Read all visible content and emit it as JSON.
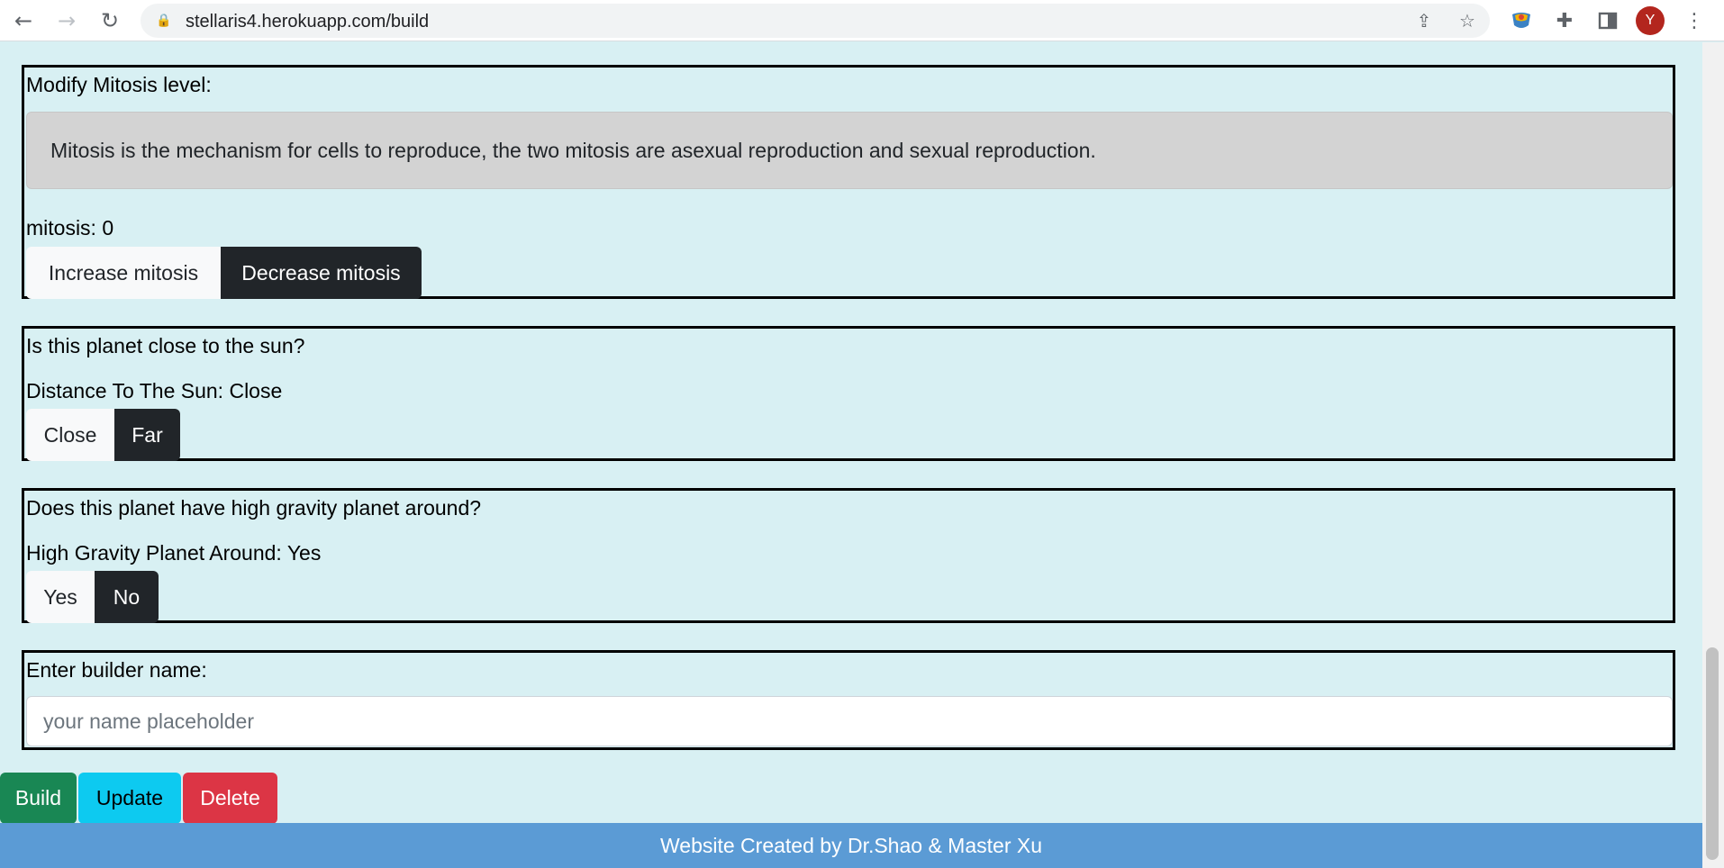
{
  "browser": {
    "url": "stellaris4.herokuapp.com/build",
    "avatar_letter": "Y"
  },
  "mitosis": {
    "label": "Modify Mitosis level:",
    "info": "Mitosis is the mechanism for cells to reproduce, the two mitosis are asexual reproduction and sexual reproduction.",
    "status_key": "mitosis:",
    "status_value": "0",
    "increase_label": "Increase mitosis",
    "decrease_label": "Decrease mitosis"
  },
  "sun": {
    "label": "Is this planet close to the sun?",
    "status_key": "Distance To The Sun:",
    "status_value": "Close",
    "close_label": "Close",
    "far_label": "Far"
  },
  "gravity": {
    "label": "Does this planet have high gravity planet around?",
    "status_key": "High Gravity Planet Around:",
    "status_value": "Yes",
    "yes_label": "Yes",
    "no_label": "No"
  },
  "builder": {
    "label": "Enter builder name:",
    "placeholder": "your name placeholder"
  },
  "actions": {
    "build_label": "Build",
    "update_label": "Update",
    "delete_label": "Delete"
  },
  "footer": {
    "text": "Website Created by Dr.Shao & Master Xu"
  },
  "colors": {
    "page_bg": "#d8f0f3",
    "build": "#198754",
    "update": "#0dcaf0",
    "delete": "#dc3545",
    "footer": "#5b9bd5",
    "dark_button": "#212529"
  }
}
